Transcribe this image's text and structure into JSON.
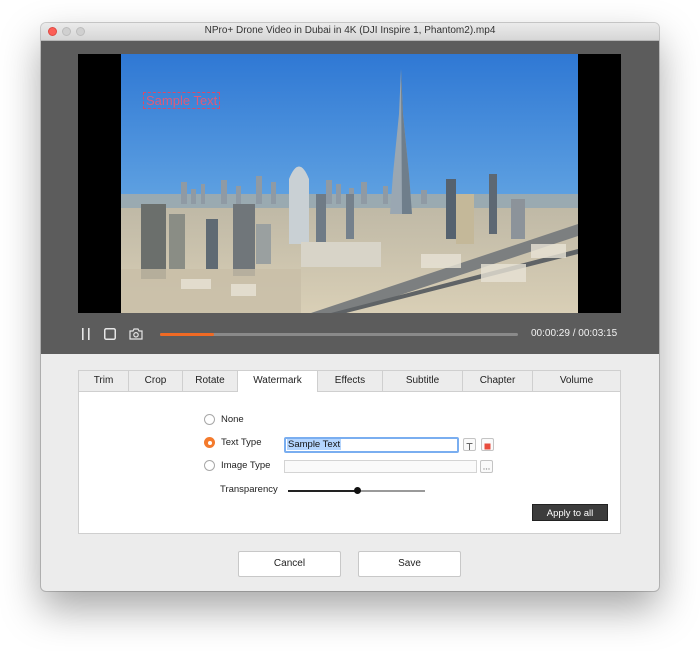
{
  "window": {
    "title": "NPro+ Drone Video in Dubai in 4K (DJI Inspire 1, Phantom2).mp4"
  },
  "player": {
    "watermark_text": "Sample Text",
    "current_time": "00:00:29",
    "total_time": "00:03:15",
    "time_separator": " / ",
    "progress": 0.15,
    "controls": {
      "pause_icon": "pause-icon",
      "stop_icon": "stop-icon",
      "snapshot_icon": "camera-icon"
    },
    "colors": {
      "progress": "#f06a24",
      "watermark": "#e05a78"
    }
  },
  "tabs": [
    "Trim",
    "Crop",
    "Rotate",
    "Watermark",
    "Effects",
    "Subtitle",
    "Chapter",
    "Volume"
  ],
  "active_tab": "Watermark",
  "watermark": {
    "options": {
      "none": "None",
      "text": "Text Type",
      "image": "Image Type"
    },
    "selected": "Text Type",
    "text_value": "Sample Text",
    "image_value": "",
    "transparency_label": "Transparency",
    "transparency": 0.5,
    "apply_all_label": "Apply to all",
    "font_icon": "text-font-icon",
    "color_icon": "color-swatch-icon",
    "color_value": "#e84c3d",
    "browse_icon": "ellipsis-icon"
  },
  "footer": {
    "cancel_label": "Cancel",
    "save_label": "Save"
  }
}
